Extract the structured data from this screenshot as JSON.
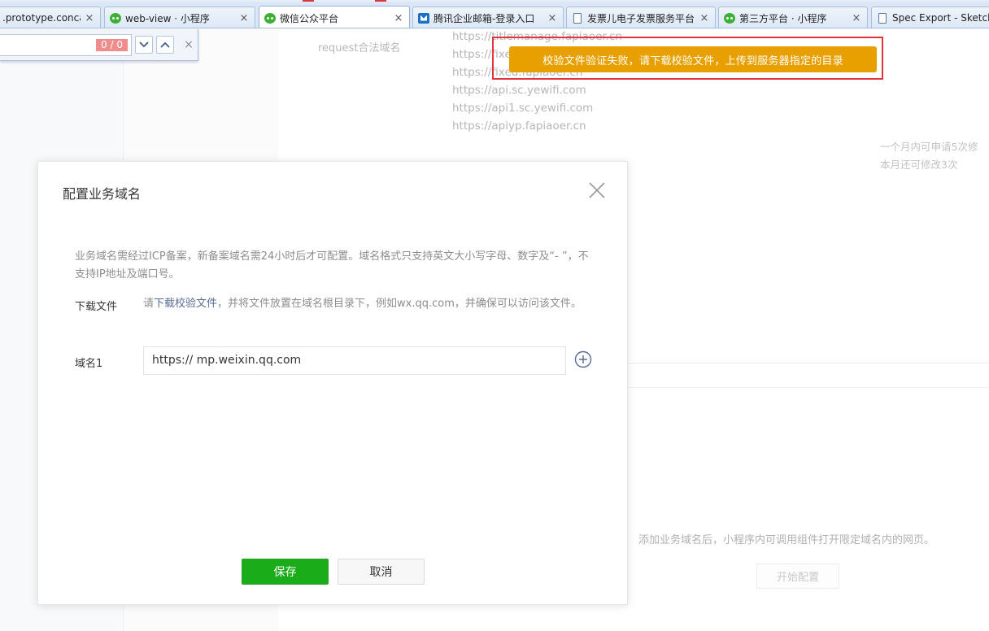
{
  "browser": {
    "tabs": [
      {
        "label": ".prototype.concat",
        "icon": "none"
      },
      {
        "label": "web-view · 小程序",
        "icon": "wechat-icon"
      },
      {
        "label": "微信公众平台",
        "icon": "wechat-icon",
        "active": true
      },
      {
        "label": "腾讯企业邮箱-登录入口",
        "icon": "mail-icon"
      },
      {
        "label": "发票儿电子发票服务平台",
        "icon": "doc-icon"
      },
      {
        "label": "第三方平台 · 小程序",
        "icon": "wechat-icon"
      },
      {
        "label": "Spec Export - Sketch",
        "icon": "doc-icon"
      }
    ],
    "close_glyph": "×"
  },
  "find_bar": {
    "query": "",
    "count": "0 / 0",
    "next_glyph": "⌄",
    "prev_glyph": "⌃",
    "close_glyph": "×"
  },
  "background": {
    "section_label": "request合法域名",
    "domains": [
      "https://titlemanage.fapiaoer.cn",
      "https://fixed",
      "https://fixed.fapiaoer.cn",
      "https://api.sc.yewifi.com",
      "https://api1.sc.yewifi.com",
      "https://apiyp.fapiaoer.cn"
    ],
    "side_note_line1": "一个月内可申请5次修",
    "side_note_line2": "本月还可修改3次",
    "empty_tip": "添加业务域名后，小程序内可调用组件打开限定域名内的网页。",
    "start_button": "开始配置"
  },
  "toast": {
    "message": "校验文件验证失败，请下载校验文件，上传到服务器指定的目录",
    "color": "#e8a000",
    "highlight_color": "#e3343c"
  },
  "dialog": {
    "title": "配置业务域名",
    "description": "业务域名需经过ICP备案，新备案域名需24小时后才可配置。域名格式只支持英文大小写字母、数字及“- ”，不支持IP地址及端口号。",
    "download_label": "下载文件",
    "download_prefix": "请",
    "download_link": "下载校验文件",
    "download_suffix": "，并将文件放置在域名根目录下，例如wx.qq.com，并确保可以访问该文件。",
    "domain_label": "域名1",
    "domain_value": "https:// mp.weixin.qq.com",
    "save_button": "保存",
    "cancel_button": "取消",
    "primary_color": "#1aad19"
  }
}
